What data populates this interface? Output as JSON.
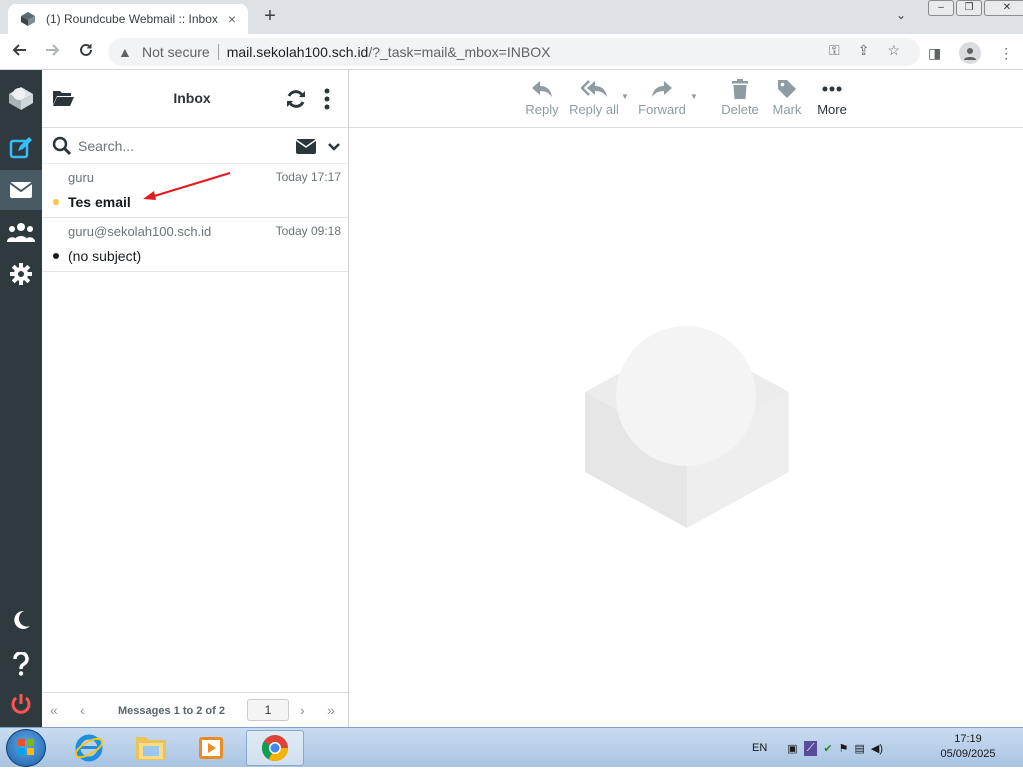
{
  "browser": {
    "tab_title": "(1) Roundcube Webmail :: Inbox",
    "tab_close": "×",
    "new_tab": "+",
    "not_secure": "Not secure",
    "url_host": "mail.sekolah100.sch.id",
    "url_path": "/?_task=mail&_mbox=INBOX"
  },
  "rail": {
    "items": [
      "logo-icon",
      "compose-icon",
      "mail-icon",
      "contacts-icon",
      "settings-icon"
    ],
    "bottom": [
      "dark-mode-icon",
      "help-icon",
      "logout-icon"
    ]
  },
  "list": {
    "title": "Inbox",
    "search_placeholder": "Search...",
    "messages": [
      {
        "from": "guru",
        "date": "Today 17:17",
        "subject": "Tes email",
        "unread": true
      },
      {
        "from": "guru@sekolah100.sch.id",
        "date": "Today 09:18",
        "subject": "(no subject)",
        "unread": false
      }
    ],
    "pager_text": "Messages 1 to 2 of 2",
    "page": "1"
  },
  "toolbar": {
    "reply": "Reply",
    "reply_all": "Reply all",
    "forward": "Forward",
    "delete": "Delete",
    "mark": "Mark",
    "more": "More"
  },
  "taskbar": {
    "lang": "EN",
    "time": "17:19",
    "date": "05/09/2025"
  },
  "colors": {
    "rail_bg": "#2f3a3f",
    "accent": "#37beff",
    "unread_dot": "#f7c443",
    "logout": "#ff5552"
  }
}
